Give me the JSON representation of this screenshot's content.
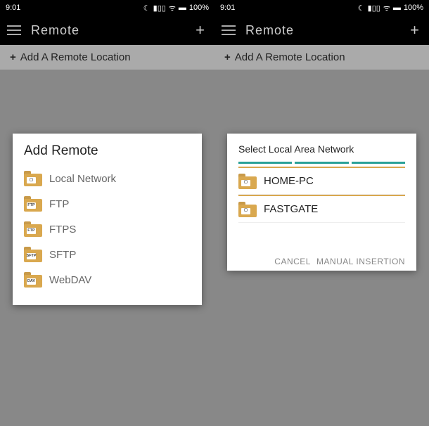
{
  "statusbar": {
    "time": "9:01",
    "battery": "100%"
  },
  "appbar": {
    "title": "Remote"
  },
  "subheader": {
    "plus": "+",
    "label": "Add A Remote Location"
  },
  "dialog1": {
    "title": "Add Remote",
    "items": [
      {
        "badge": "▢",
        "label": "Local Network"
      },
      {
        "badge": "FTP",
        "label": "FTP"
      },
      {
        "badge": "FTP",
        "label": "FTPS"
      },
      {
        "badge": "SFTP",
        "label": "SFTP"
      },
      {
        "badge": "DAV",
        "label": "WebDAV"
      }
    ]
  },
  "dialog2": {
    "title": "Select Local Area Network",
    "items": [
      {
        "badge": "▢",
        "label": "HOME-PC"
      },
      {
        "badge": "▢",
        "label": "FASTGATE"
      }
    ],
    "cancel": "CANCEL",
    "manual": "MANUAL INSERTION"
  }
}
